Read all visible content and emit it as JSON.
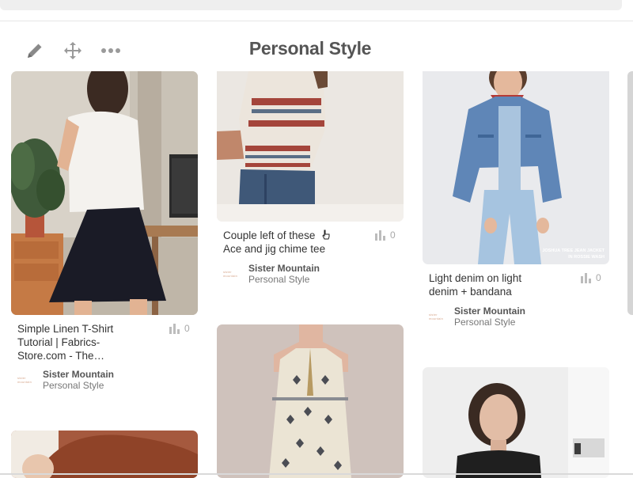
{
  "board": {
    "title": "Personal Style"
  },
  "toolbar": {
    "edit_icon": "pencil-icon",
    "move_icon": "move-arrows-icon",
    "more_icon": "more-dots-icon"
  },
  "pins": [
    {
      "caption_line1": "Simple Linen T-Shirt",
      "caption_line2": "Tutorial | Fabrics-",
      "caption_line3": "Store.com - The…",
      "repins": "0",
      "pinner": "Sister Mountain",
      "board": "Personal Style"
    },
    {
      "caption_line1": "Couple left of these",
      "caption_line2": "Ace and jig chime tee",
      "repins": "0",
      "pinner": "Sister Mountain",
      "board": "Personal Style"
    },
    {
      "caption_line1": "Light denim on light",
      "caption_line2": "denim + bandana",
      "repins": "0",
      "pinner": "Sister Mountain",
      "board": "Personal Style",
      "image_overlay_line1": "JOSHUA TREE JEAN JACKET",
      "image_overlay_line2": "IN ROSSIE WASH"
    }
  ],
  "avatar_text": "sister mountain",
  "colors": {
    "title": "#555555",
    "caption": "#333333",
    "meta": "#a8a8a8",
    "avatar": "#d7a88e"
  }
}
